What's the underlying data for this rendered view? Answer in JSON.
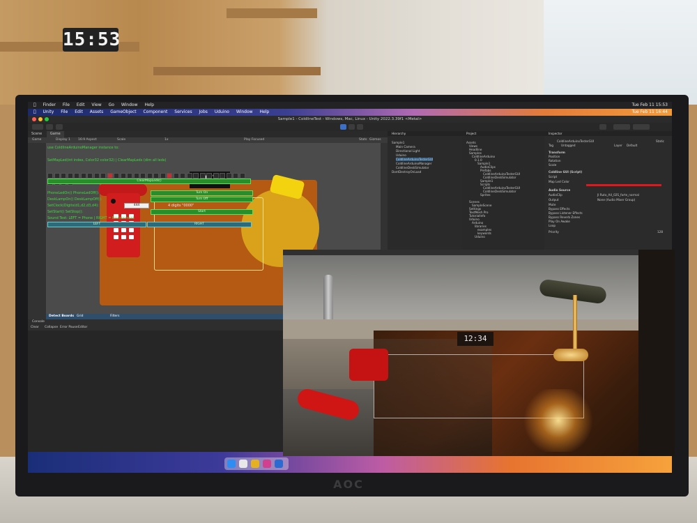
{
  "room": {
    "wall_clock": "15:53",
    "monitor_brand": "AOC"
  },
  "mac_menubar": {
    "items": [
      "Finder",
      "File",
      "Edit",
      "View",
      "Go",
      "Window",
      "Help"
    ],
    "clock": "Tue Feb 11  15:53"
  },
  "unity_menubar": {
    "items": [
      "Unity",
      "File",
      "Edit",
      "Assets",
      "GameObject",
      "Component",
      "Services",
      "Jobs",
      "Uduino",
      "Window",
      "Help"
    ],
    "clock": "Tue Feb 11  16:44"
  },
  "window": {
    "title": "Sample1 - ColdlineTest - Windows, Mac, Linux - Unity 2022.3.39f1 <Metal>"
  },
  "game_panel": {
    "tabs": [
      "Scene",
      "Game"
    ],
    "toolbar": {
      "mode": "Game",
      "display": "Display 1",
      "aspect": "16:9 Aspect",
      "scale_label": "Scale",
      "scale_value": "1x",
      "play_focused": "Play Focused",
      "stats": "Stats",
      "gizmos": "Gizmos"
    },
    "gui_lines": [
      "use ColdlineArduinoManager instance to:",
      "SetMapLed(int index, Color32 color32) | ClearMapLeds (dim all leds)",
      "PhoneLedOn() PhoneLedOff():",
      "DeskLampOn() DeskLampOff():",
      "SetClock(Digits(d1,d2,d3,d4):",
      "SetStart() SetStop():",
      "Sound Test: LEFT = Phone | RIGHT = Environment"
    ],
    "buttons": {
      "clear_map_leds": "ClearMapLeds()",
      "turn_on": "Turn On",
      "turn_off": "Turn Off",
      "start": "Start",
      "left": "LEFT",
      "right": "RIGHT",
      "digit_field": "444",
      "digit_hint": "4 digits \"0000\""
    },
    "clock_digits": "12 34",
    "bottom_tabs": [
      "Detect Boards",
      "Grid",
      "Filters"
    ]
  },
  "console": {
    "tab": "Console",
    "toolbar": [
      "Clear",
      "Collapse",
      "Error Pause",
      "Editor"
    ]
  },
  "hierarchy": {
    "title": "Hierarchy",
    "items": [
      "Sample1",
      "Main Camera",
      "Directional Light",
      "Uduino",
      "ColdlineArduinoTesterGUI",
      "ColdlineArduinoManager",
      "ColdlineDeskSimulator",
      "DontDestroyOnLoad"
    ]
  },
  "project": {
    "title": "Project",
    "items": [
      "Assets",
      "Views",
      "Headline",
      "Samples",
      "ColdlineArduino",
      "0.1.0",
      "Sample1",
      "AudioClips",
      "Prefabs",
      "ColdlineArduinoTesterGUI",
      "ColdlineDeskSimulator",
      "Sample1",
      "Scripts",
      "ColdlineArduinoTesterGUI",
      "ColdlineDeskSimulator",
      "Sprites",
      "Scenes",
      "SampleScene",
      "Settings",
      "TextMesh Pro",
      "TutorialInfo",
      "Uduino",
      "Arduino",
      "libraries",
      "examples",
      "keywords",
      "Uduino"
    ]
  },
  "inspector": {
    "title": "Inspector",
    "object_name": "ColdlineArduinoTesterGUI",
    "static": "Static",
    "tag": "Untagged",
    "layer": "Default",
    "transform": "Transform",
    "position": "Position",
    "rotation": "Rotation",
    "scale": "Scale",
    "component1": "Coldline GUI (Script)",
    "script_label": "Script",
    "map_led_color": "Map Led Color",
    "component2": "Audio Source",
    "audio_clip_label": "AudioClip",
    "audio_clip_value": "JI Ruto_A4_02S_forte_normal",
    "output_label": "Output",
    "output_value": "None (Audio Mixer Group)",
    "props": [
      "Mute",
      "Bypass Effects",
      "Bypass Listener Effects",
      "Bypass Reverb Zones",
      "Play On Awake",
      "Loop"
    ],
    "priority": "Priority",
    "priority_value": "128",
    "accent": "#e0181e"
  },
  "colors": {
    "game_bg": "#b55a12",
    "gui_text": "#3fdc3f",
    "phone_red": "#d11d1d",
    "lamp_yellow": "#f3d20f"
  },
  "photo": {
    "desk_clock": "12:34"
  }
}
